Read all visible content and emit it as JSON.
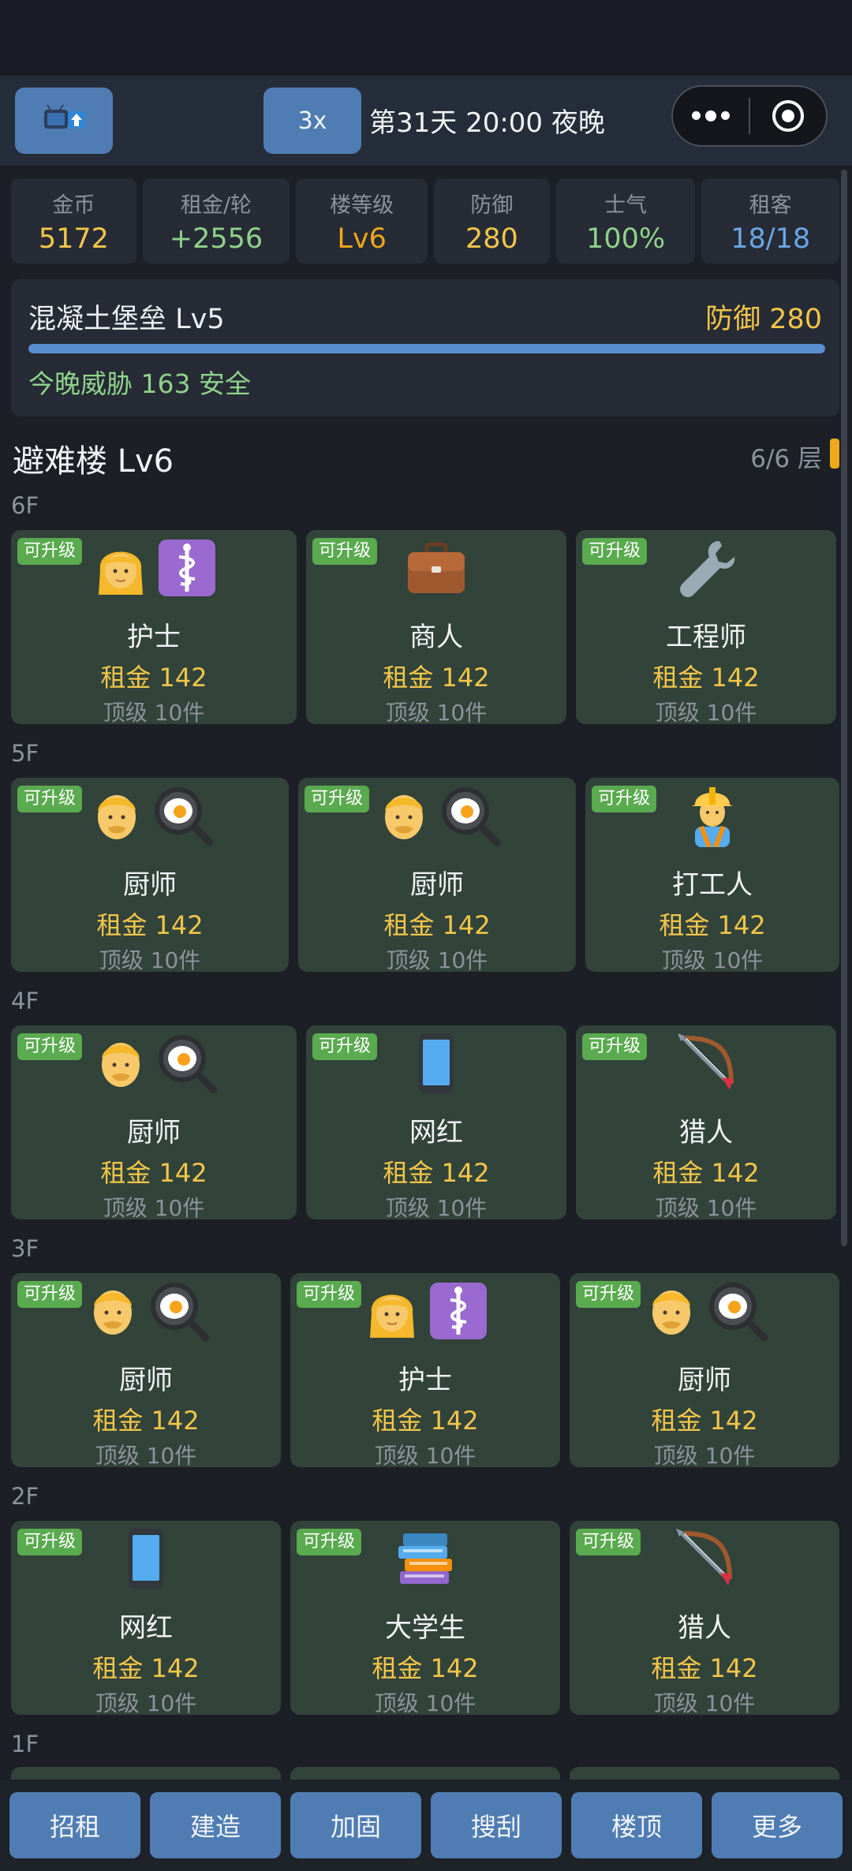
{
  "header": {
    "speed": "3x",
    "day_text": "第31天 20:00 夜晚"
  },
  "stats": [
    {
      "label": "金币",
      "value": "5172",
      "color": "#f3c64a"
    },
    {
      "label": "租金/轮",
      "value": "+2556",
      "color": "#8fd28b"
    },
    {
      "label": "楼等级",
      "value": "Lv6",
      "color": "#f0a71b"
    },
    {
      "label": "防御",
      "value": "280",
      "color": "#f3c64a"
    },
    {
      "label": "士气",
      "value": "100%",
      "color": "#8fd28b"
    },
    {
      "label": "租客",
      "value": "18/18",
      "color": "#6aa6e6"
    }
  ],
  "fortress": {
    "name": "混凝土堡垒 Lv5",
    "defense": "防御 280",
    "threat": "今晚威胁 163 安全",
    "bar_fill": 1.0
  },
  "building": {
    "title": "避难楼 Lv6",
    "floors": "6/6 层"
  },
  "floors": [
    {
      "label": "6F",
      "rooms": [
        {
          "badge": "可升级",
          "icons": [
            "woman-icon",
            "medical-icon"
          ],
          "job": "护士",
          "rent": "租金 142",
          "top": "顶级 10件"
        },
        {
          "badge": "可升级",
          "icons": [
            "briefcase-icon"
          ],
          "job": "商人",
          "rent": "租金 142",
          "top": "顶级 10件"
        },
        {
          "badge": "可升级",
          "icons": [
            "wrench-icon"
          ],
          "job": "工程师",
          "rent": "租金 142",
          "top": "顶级 10件"
        }
      ]
    },
    {
      "label": "5F",
      "rooms": [
        {
          "badge": "可升级",
          "icons": [
            "man-icon",
            "frying-pan-icon"
          ],
          "job": "厨师",
          "rent": "租金 142",
          "top": "顶级 10件"
        },
        {
          "badge": "可升级",
          "icons": [
            "man-icon",
            "frying-pan-icon"
          ],
          "job": "厨师",
          "rent": "租金 142",
          "top": "顶级 10件"
        },
        {
          "badge": "可升级",
          "icons": [
            "construction-worker-icon"
          ],
          "job": "打工人",
          "rent": "租金 142",
          "top": "顶级 10件"
        }
      ]
    },
    {
      "label": "4F",
      "rooms": [
        {
          "badge": "可升级",
          "icons": [
            "man-icon",
            "frying-pan-icon"
          ],
          "job": "厨师",
          "rent": "租金 142",
          "top": "顶级 10件"
        },
        {
          "badge": "可升级",
          "icons": [
            "phone-icon"
          ],
          "job": "网红",
          "rent": "租金 142",
          "top": "顶级 10件"
        },
        {
          "badge": "可升级",
          "icons": [
            "bow-arrow-icon"
          ],
          "job": "猎人",
          "rent": "租金 142",
          "top": "顶级 10件"
        }
      ]
    },
    {
      "label": "3F",
      "rooms": [
        {
          "badge": "可升级",
          "icons": [
            "man-icon",
            "frying-pan-icon"
          ],
          "job": "厨师",
          "rent": "租金 142",
          "top": "顶级 10件"
        },
        {
          "badge": "可升级",
          "icons": [
            "woman-icon",
            "medical-icon"
          ],
          "job": "护士",
          "rent": "租金 142",
          "top": "顶级 10件"
        },
        {
          "badge": "可升级",
          "icons": [
            "man-icon",
            "frying-pan-icon"
          ],
          "job": "厨师",
          "rent": "租金 142",
          "top": "顶级 10件"
        }
      ]
    },
    {
      "label": "2F",
      "rooms": [
        {
          "badge": "可升级",
          "icons": [
            "phone-icon"
          ],
          "job": "网红",
          "rent": "租金 142",
          "top": "顶级 10件"
        },
        {
          "badge": "可升级",
          "icons": [
            "books-icon"
          ],
          "job": "大学生",
          "rent": "租金 142",
          "top": "顶级 10件"
        },
        {
          "badge": "可升级",
          "icons": [
            "bow-arrow-icon"
          ],
          "job": "猎人",
          "rent": "租金 142",
          "top": "顶级 10件"
        }
      ]
    },
    {
      "label": "1F",
      "rooms": []
    }
  ],
  "bottom_nav": [
    "招租",
    "建造",
    "加固",
    "搜刮",
    "楼顶",
    "更多"
  ]
}
